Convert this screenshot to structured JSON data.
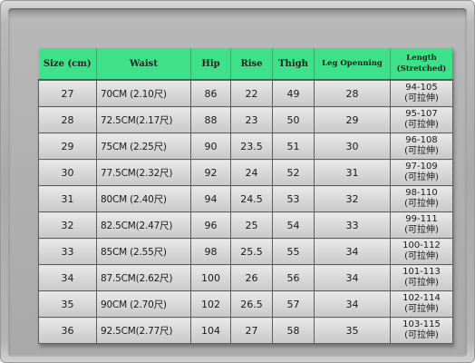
{
  "table": {
    "headers": {
      "size": "Size (cm)",
      "waist": "Waist",
      "hip": "Hip",
      "rise": "Rise",
      "thigh": "Thigh",
      "leg": "Leg Openning",
      "length_line1": "Length",
      "length_line2": "(Stretched)"
    },
    "rows": [
      {
        "size": "27",
        "waist": "70CM  (2.10尺)",
        "hip": "86",
        "rise": "22",
        "thigh": "49",
        "leg": "28",
        "length": "94-105",
        "note": "(可拉伸)"
      },
      {
        "size": "28",
        "waist": "72.5CM(2.17尺)",
        "hip": "88",
        "rise": "23",
        "thigh": "50",
        "leg": "29",
        "length": "95-107",
        "note": "(可拉伸)"
      },
      {
        "size": "29",
        "waist": "75CM  (2.25尺)",
        "hip": "90",
        "rise": "23.5",
        "thigh": "51",
        "leg": "30",
        "length": "96-108",
        "note": "(可拉伸)"
      },
      {
        "size": "30",
        "waist": "77.5CM(2.32尺)",
        "hip": "92",
        "rise": "24",
        "thigh": "52",
        "leg": "31",
        "length": "97-109",
        "note": "(可拉伸)"
      },
      {
        "size": "31",
        "waist": "80CM  (2.40尺)",
        "hip": "94",
        "rise": "24.5",
        "thigh": "53",
        "leg": "32",
        "length": "98-110",
        "note": "(可拉伸)"
      },
      {
        "size": "32",
        "waist": "82.5CM(2.47尺)",
        "hip": "96",
        "rise": "25",
        "thigh": "54",
        "leg": "33",
        "length": "99-111",
        "note": "(可拉伸)"
      },
      {
        "size": "33",
        "waist": "85CM  (2.55尺)",
        "hip": "98",
        "rise": "25.5",
        "thigh": "55",
        "leg": "34",
        "length": "100-112",
        "note": "(可拉伸)"
      },
      {
        "size": "34",
        "waist": "87.5CM(2.62尺)",
        "hip": "100",
        "rise": "26",
        "thigh": "56",
        "leg": "34",
        "length": "101-113",
        "note": "(可拉伸)"
      },
      {
        "size": "35",
        "waist": "90CM  (2.70尺)",
        "hip": "102",
        "rise": "26.5",
        "thigh": "57",
        "leg": "34",
        "length": "102-114",
        "note": "(可拉伸)"
      },
      {
        "size": "36",
        "waist": "92.5CM(2.77尺)",
        "hip": "104",
        "rise": "27",
        "thigh": "58",
        "leg": "35",
        "length": "103-115",
        "note": "(可拉伸)"
      }
    ]
  },
  "colors": {
    "header_bg": "#3ee08a",
    "cell_bg": "#d9d9d9",
    "frame_bg": "#b0b0b0"
  }
}
